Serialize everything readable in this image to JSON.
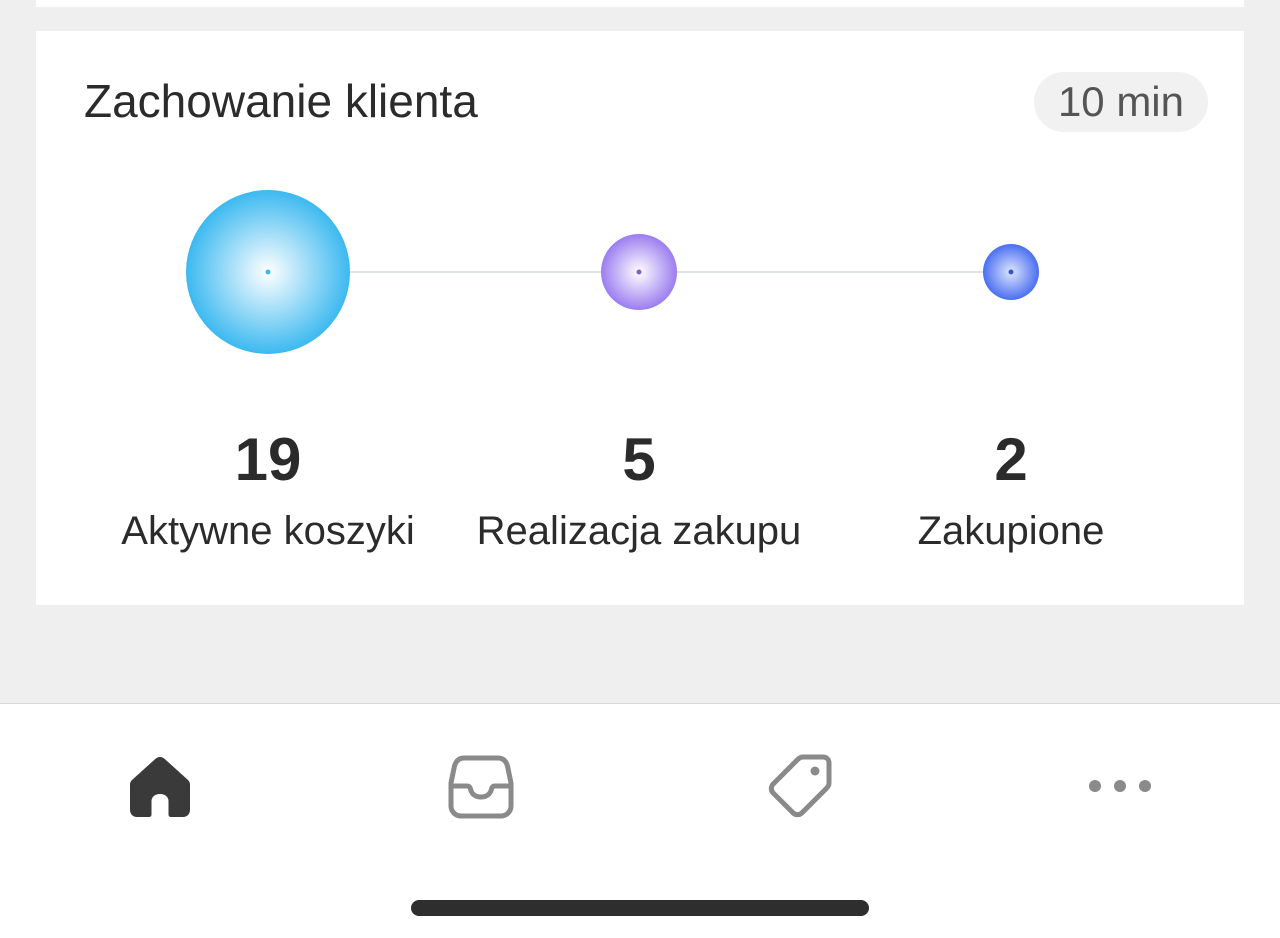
{
  "card": {
    "title": "Zachowanie klienta",
    "badge": "10 min"
  },
  "funnel": {
    "stages": [
      {
        "value": "19",
        "label": "Aktywne koszyki",
        "color_inner": "#ffffff",
        "color_outer": "#3cb9f0"
      },
      {
        "value": "5",
        "label": "Realizacja zakupu",
        "color_inner": "#ffffff",
        "color_outer": "#9b7df0"
      },
      {
        "value": "2",
        "label": "Zakupione",
        "color_inner": "#ffffff",
        "color_outer": "#4a6ff0"
      }
    ]
  },
  "nav": {
    "items": [
      {
        "icon": "home-icon",
        "active": true
      },
      {
        "icon": "inbox-icon",
        "active": false
      },
      {
        "icon": "tag-icon",
        "active": false
      },
      {
        "icon": "more-icon",
        "active": false
      }
    ],
    "active_color": "#3a3a3a",
    "inactive_color": "#8a8a8a"
  }
}
